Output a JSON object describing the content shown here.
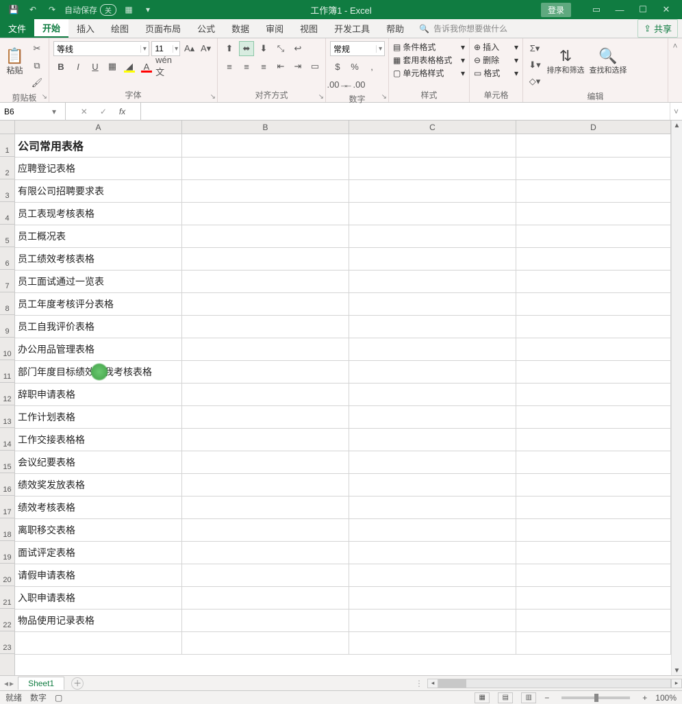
{
  "title": "工作簿1 - Excel",
  "qat": {
    "autosave_label": "自动保存",
    "autosave_state": "关"
  },
  "login_label": "登录",
  "ribbon_tabs": [
    "文件",
    "开始",
    "插入",
    "绘图",
    "页面布局",
    "公式",
    "数据",
    "审阅",
    "视图",
    "开发工具",
    "帮助"
  ],
  "active_tab_index": 1,
  "tell_me_placeholder": "告诉我你想要做什么",
  "share_label": "共享",
  "ribbon_groups": {
    "clipboard": {
      "label": "剪贴板",
      "paste": "粘贴"
    },
    "font": {
      "label": "字体",
      "font_name": "等线",
      "font_size": "11"
    },
    "alignment": {
      "label": "对齐方式"
    },
    "number": {
      "label": "数字",
      "format": "常规"
    },
    "styles": {
      "label": "样式",
      "conditional": "条件格式",
      "table_format": "套用表格格式",
      "cell_styles": "单元格样式"
    },
    "cells": {
      "label": "单元格",
      "insert": "插入",
      "delete": "删除",
      "format": "格式"
    },
    "editing": {
      "label": "编辑",
      "sort_filter": "排序和筛选",
      "find_select": "查找和选择"
    }
  },
  "name_box": "B6",
  "formula_value": "",
  "columns": [
    "A",
    "B",
    "C",
    "D"
  ],
  "rows_visible": 23,
  "sheet_tabs": [
    "Sheet1"
  ],
  "status": {
    "ready": "就绪",
    "mode": "数字",
    "zoom": "100%"
  },
  "chart_data": {
    "type": "table",
    "title": "公司常用表格",
    "columns": [
      "A"
    ],
    "rows": [
      "公司常用表格",
      "应聘登记表格",
      "有限公司招聘要求表",
      "员工表现考核表格",
      "员工概况表",
      "员工绩效考核表格",
      "员工面试通过一览表",
      "员工年度考核评分表格",
      "员工自我评价表格",
      "办公用品管理表格",
      "部门年度目标绩效自我考核表格",
      "辞职申请表格",
      "工作计划表格",
      "工作交接表格格",
      "会议纪要表格",
      "绩效奖发放表格",
      "绩效考核表格",
      "离职移交表格",
      "面试评定表格",
      "请假申请表格",
      "入职申请表格",
      "物品使用记录表格"
    ]
  }
}
